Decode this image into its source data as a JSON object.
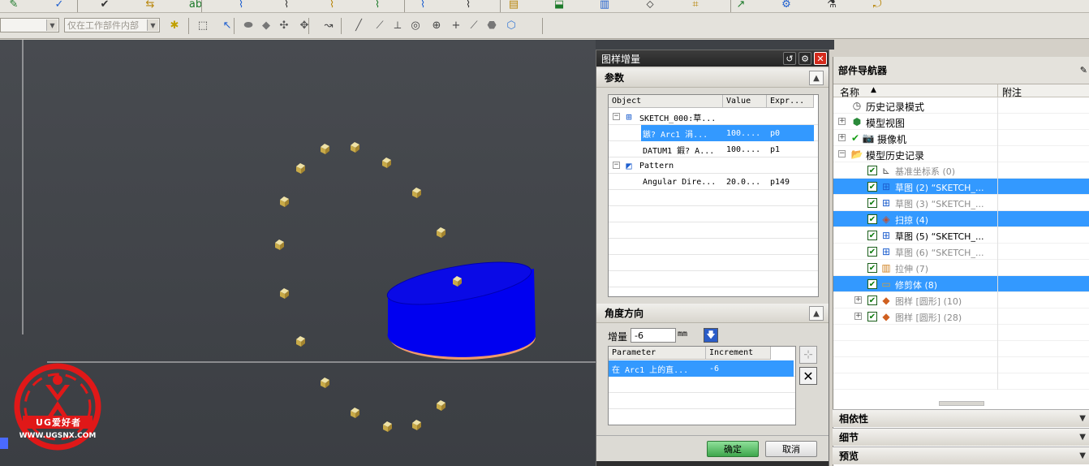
{
  "toolbar": {
    "filter_combo": "仅在工作部件内部",
    "icons_row1": [
      "note-icon",
      "blend-icon",
      "chamfer-icon",
      "hole-icon",
      "text-style-icon",
      "sketch-icon",
      "pattern-icon",
      "expression-icon",
      "measure-icon",
      "check-icon",
      "table-icon",
      "drafting-icon",
      "render-icon",
      "analysis-icon",
      "curve-icon",
      "surface-icon",
      "edit-icon",
      "feature-icon",
      "reverse-icon",
      "options-icon"
    ],
    "icons_row2": [
      "snap-point-icon",
      "rectangle-select-icon",
      "select-icon",
      "cylinder-icon",
      "extrude-icon",
      "revolve-icon",
      "sweep-icon",
      "curve-select-icon",
      "line-icon",
      "tangent-icon",
      "arc-center-icon",
      "circle-center-icon",
      "quadrant-icon",
      "plus-icon",
      "polyline-icon",
      "face-icon",
      "cube-icon"
    ]
  },
  "dialog": {
    "title": "图样增量",
    "parameters_section": "参数",
    "columns": [
      "Object",
      "Value",
      "Expr..."
    ],
    "rows": [
      {
        "object": "SKETCH_000:草...",
        "value": "",
        "expr": ""
      },
      {
        "object": "鏃? Arc1 涓...",
        "value": "100....",
        "expr": "p0"
      },
      {
        "object": "DATUM1 鍜? A...",
        "value": "100....",
        "expr": "p1"
      },
      {
        "object": "Pattern",
        "value": "",
        "expr": ""
      },
      {
        "object": "Angular Dire...",
        "value": "20.0...",
        "expr": "p149"
      }
    ],
    "angle_section": "角度方向",
    "increment_label": "增量",
    "increment_value": "-6",
    "increment_unit": "mm",
    "param_columns": [
      "Parameter",
      "Increment"
    ],
    "param_rows": [
      {
        "parameter": "在 Arc1 上的直...",
        "increment": "-6"
      }
    ],
    "ok": "确定",
    "cancel": "取消"
  },
  "navigator": {
    "title": "部件导航器",
    "col_name": "名称",
    "col_note": "附注",
    "items": [
      {
        "label": "历史记录模式",
        "icon": "clock-icon",
        "grey": false,
        "selected": false,
        "indent": 0
      },
      {
        "label": "模型视图",
        "icon": "model-views-icon",
        "grey": false,
        "selected": false,
        "indent": 0
      },
      {
        "label": "摄像机",
        "icon": "camera-icon",
        "grey": false,
        "selected": false,
        "indent": 0
      },
      {
        "label": "模型历史记录",
        "icon": "folder-icon",
        "grey": false,
        "selected": false,
        "indent": 0
      },
      {
        "label": "基准坐标系 (0)",
        "icon": "datum-csys-icon",
        "grey": true,
        "selected": false,
        "indent": 1
      },
      {
        "label": "草图 (2) “SKETCH_...",
        "icon": "sketch-icon",
        "grey": false,
        "selected": true,
        "indent": 1
      },
      {
        "label": "草图 (3) “SKETCH_...",
        "icon": "sketch-icon",
        "grey": true,
        "selected": false,
        "indent": 1
      },
      {
        "label": "扫掠 (4)",
        "icon": "sweep-icon",
        "grey": false,
        "selected": true,
        "indent": 1
      },
      {
        "label": "草图 (5) “SKETCH_...",
        "icon": "sketch-icon",
        "grey": false,
        "selected": false,
        "indent": 1
      },
      {
        "label": "草图 (6) “SKETCH_...",
        "icon": "sketch-icon",
        "grey": true,
        "selected": false,
        "indent": 1
      },
      {
        "label": "拉伸 (7)",
        "icon": "extrude-icon",
        "grey": true,
        "selected": false,
        "indent": 1
      },
      {
        "label": "修剪体 (8)",
        "icon": "trim-body-icon",
        "grey": false,
        "selected": true,
        "indent": 1
      },
      {
        "label": "图样 [圆形] (10)",
        "icon": "pattern-icon",
        "grey": true,
        "selected": false,
        "indent": 1
      },
      {
        "label": "图样 [圆形] (28)",
        "icon": "pattern-icon",
        "grey": true,
        "selected": false,
        "indent": 1
      }
    ],
    "panels": [
      "相依性",
      "细节",
      "预览"
    ]
  },
  "watermark": {
    "logo_text": "UG爱好者",
    "url": "WWW.UGSNX.COM"
  }
}
